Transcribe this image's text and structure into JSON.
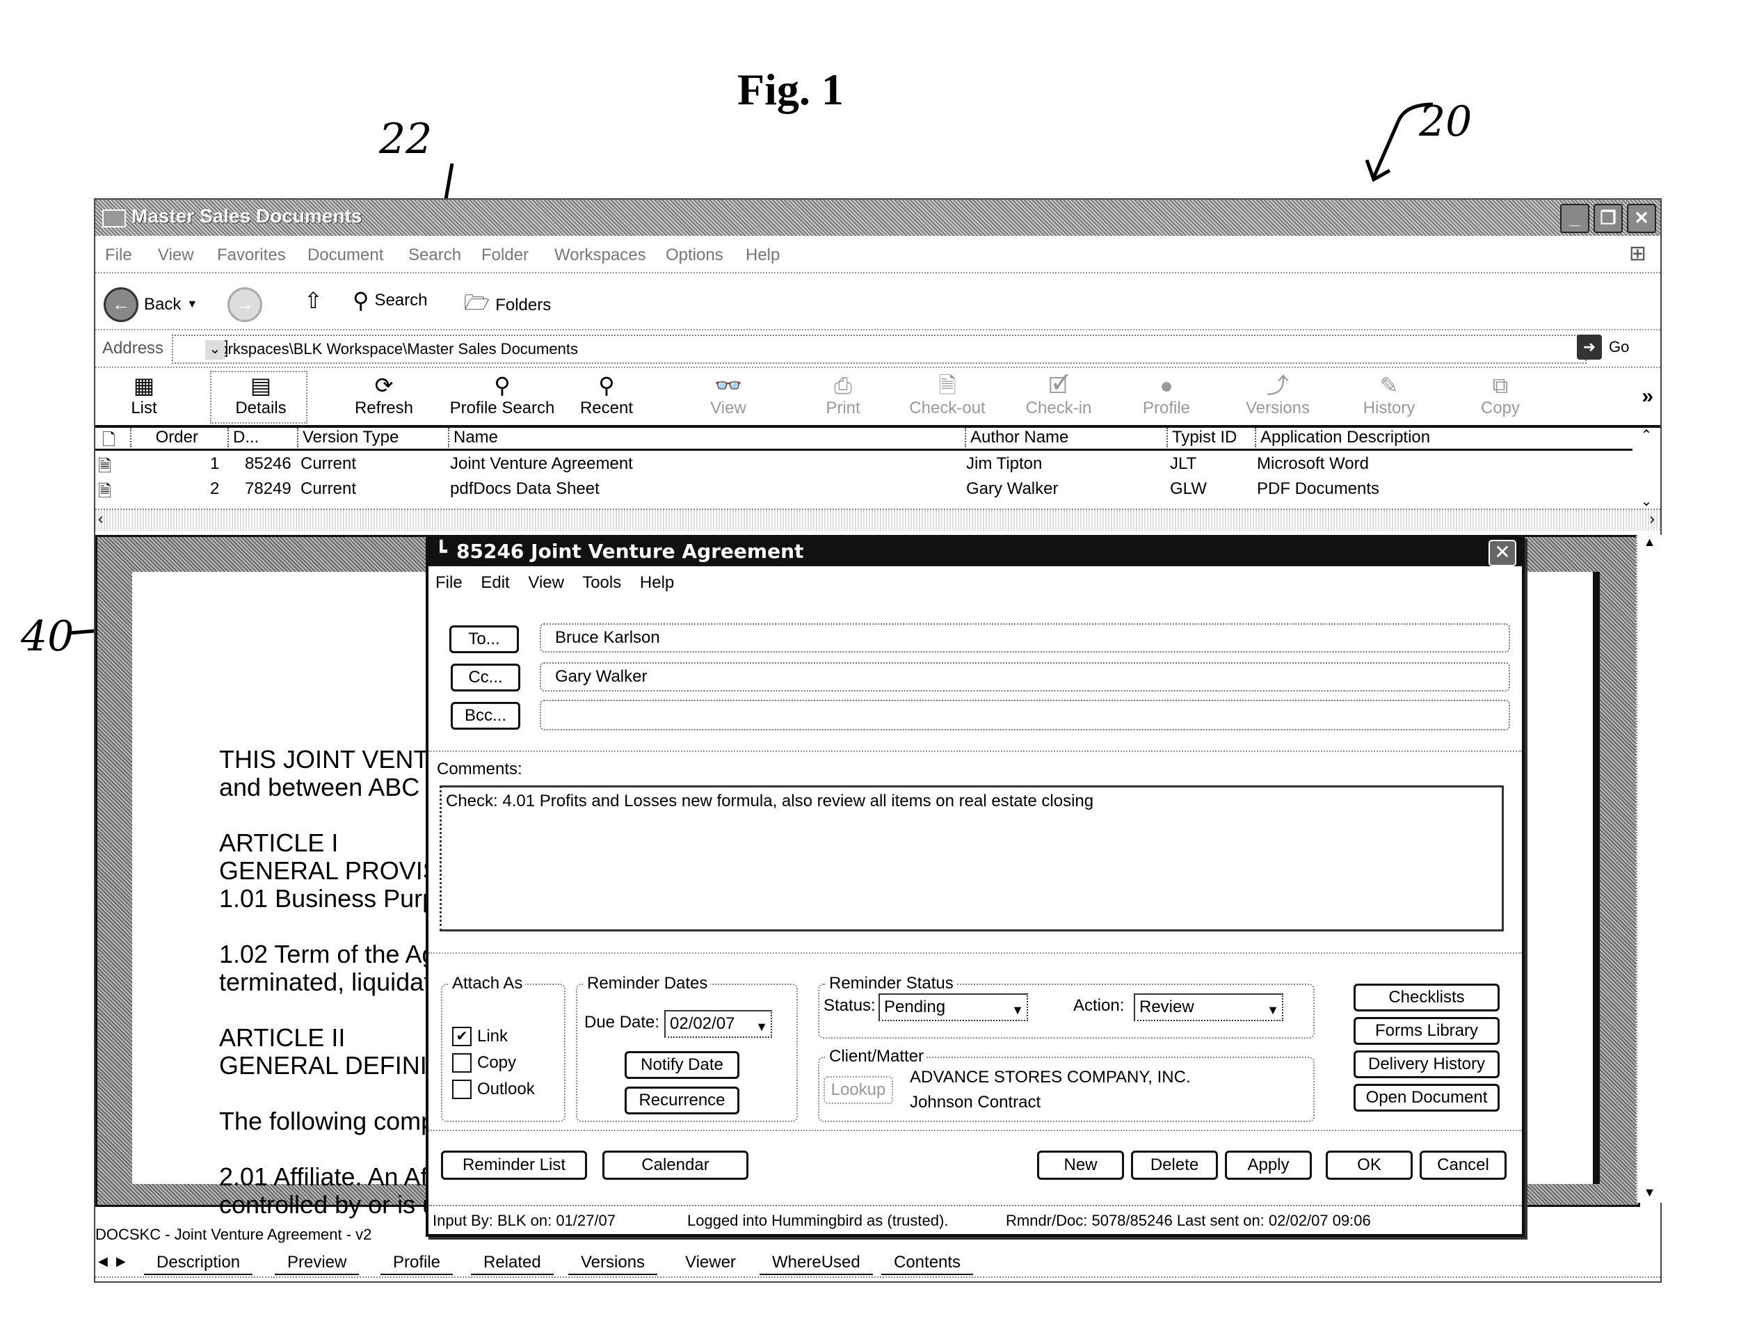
{
  "figure": {
    "title": "Fig. 1",
    "refs": {
      "window": "20",
      "toolbar": "22",
      "dialog": "40"
    }
  },
  "window": {
    "title": "Master Sales Documents",
    "menu": [
      "File",
      "View",
      "Favorites",
      "Document",
      "Search",
      "Folder",
      "Workspaces",
      "Options",
      "Help"
    ],
    "nav": {
      "back": "Back",
      "search": "Search",
      "folders": "Folders"
    },
    "address": {
      "label": "Address",
      "value": "Workspaces\\BLK Workspace\\Master Sales Documents",
      "go": "Go"
    },
    "toolbar": [
      {
        "label": "List",
        "icon": "list-view-icon",
        "enabled": true
      },
      {
        "label": "Details",
        "icon": "details-view-icon",
        "enabled": true,
        "selected": true
      },
      {
        "label": "Refresh",
        "icon": "refresh-icon",
        "enabled": true
      },
      {
        "label": "Profile Search",
        "icon": "profile-search-icon",
        "enabled": true
      },
      {
        "label": "Recent",
        "icon": "recent-icon",
        "enabled": true
      },
      {
        "label": "View",
        "icon": "view-icon",
        "enabled": false
      },
      {
        "label": "Print",
        "icon": "print-icon",
        "enabled": false
      },
      {
        "label": "Check-out",
        "icon": "check-out-icon",
        "enabled": false
      },
      {
        "label": "Check-in",
        "icon": "check-in-icon",
        "enabled": false
      },
      {
        "label": "Profile",
        "icon": "profile-icon",
        "enabled": false
      },
      {
        "label": "Versions",
        "icon": "versions-icon",
        "enabled": false
      },
      {
        "label": "History",
        "icon": "history-icon",
        "enabled": false
      },
      {
        "label": "Copy",
        "icon": "copy-icon",
        "enabled": false
      }
    ],
    "more": "»",
    "grid": {
      "columns": [
        "Order",
        "D...",
        "Version Type",
        "Name",
        "Author Name",
        "Typist ID",
        "Application Description"
      ],
      "rows": [
        {
          "order": "1",
          "doc": "85246",
          "version": "Current",
          "name": "Joint Venture Agreement",
          "author": "Jim Tipton",
          "typist": "JLT",
          "app": "Microsoft Word"
        },
        {
          "order": "2",
          "doc": "78249",
          "version": "Current",
          "name": "pdfDocs Data Sheet",
          "author": "Gary Walker",
          "typist": "GLW",
          "app": "PDF Documents"
        }
      ]
    },
    "preview_lines": "THIS JOINT VENTU\nand between ABC C\n\nARTICLE I\nGENERAL PROVIS\n1.01 Business Purpo\n\n1.02 Term of the Ag\nterminated, liquidate\n\nARTICLE II\nGENERAL DEFINIT\n\nThe following compr\n\n2.01 Affiliate. An Affi\ncontrolled by or is ur",
    "doc_label": "DOCSKC - Joint Venture Agreement - v2",
    "tabs": [
      "Description",
      "Preview",
      "Profile",
      "Related",
      "Versions",
      "Viewer",
      "WhereUsed",
      "Contents"
    ]
  },
  "dialog": {
    "title": "85246 Joint Venture Agreement",
    "menu": [
      "File",
      "Edit",
      "View",
      "Tools",
      "Help"
    ],
    "to": {
      "button": "To...",
      "value": "Bruce Karlson"
    },
    "cc": {
      "button": "Cc...",
      "value": "Gary Walker"
    },
    "bcc": {
      "button": "Bcc...",
      "value": ""
    },
    "comments_label": "Comments:",
    "comments": "Check:  4.01 Profits and Losses new formula, also review all items on real estate closing",
    "attach_as": {
      "label": "Attach As",
      "options": [
        {
          "label": "Link",
          "checked": true
        },
        {
          "label": "Copy",
          "checked": false
        },
        {
          "label": "Outlook",
          "checked": false
        }
      ]
    },
    "reminder_dates": {
      "label": "Reminder Dates",
      "due_label": "Due Date:",
      "due_value": "02/02/07",
      "notify": "Notify Date",
      "recurrence": "Recurrence"
    },
    "reminder_status": {
      "label": "Reminder Status",
      "status_label": "Status:",
      "status_value": "Pending",
      "action_label": "Action:",
      "action_value": "Review"
    },
    "client_matter": {
      "label": "Client/Matter",
      "lookup": "Lookup",
      "client": "ADVANCE STORES COMPANY, INC.",
      "matter": "Johnson Contract"
    },
    "side_buttons": [
      "Checklists",
      "Forms Library",
      "Delivery History",
      "Open Document"
    ],
    "bottom_left": [
      "Reminder List",
      "Calendar"
    ],
    "bottom_right": [
      "New",
      "Delete",
      "Apply",
      "OK",
      "Cancel"
    ],
    "status": {
      "input_by": "Input By: BLK on: 01/27/07",
      "logged": "Logged into Hummingbird as (trusted).",
      "rmndr": "Rmndr/Doc: 5078/85246  Last sent on: 02/02/07 09:06"
    }
  }
}
